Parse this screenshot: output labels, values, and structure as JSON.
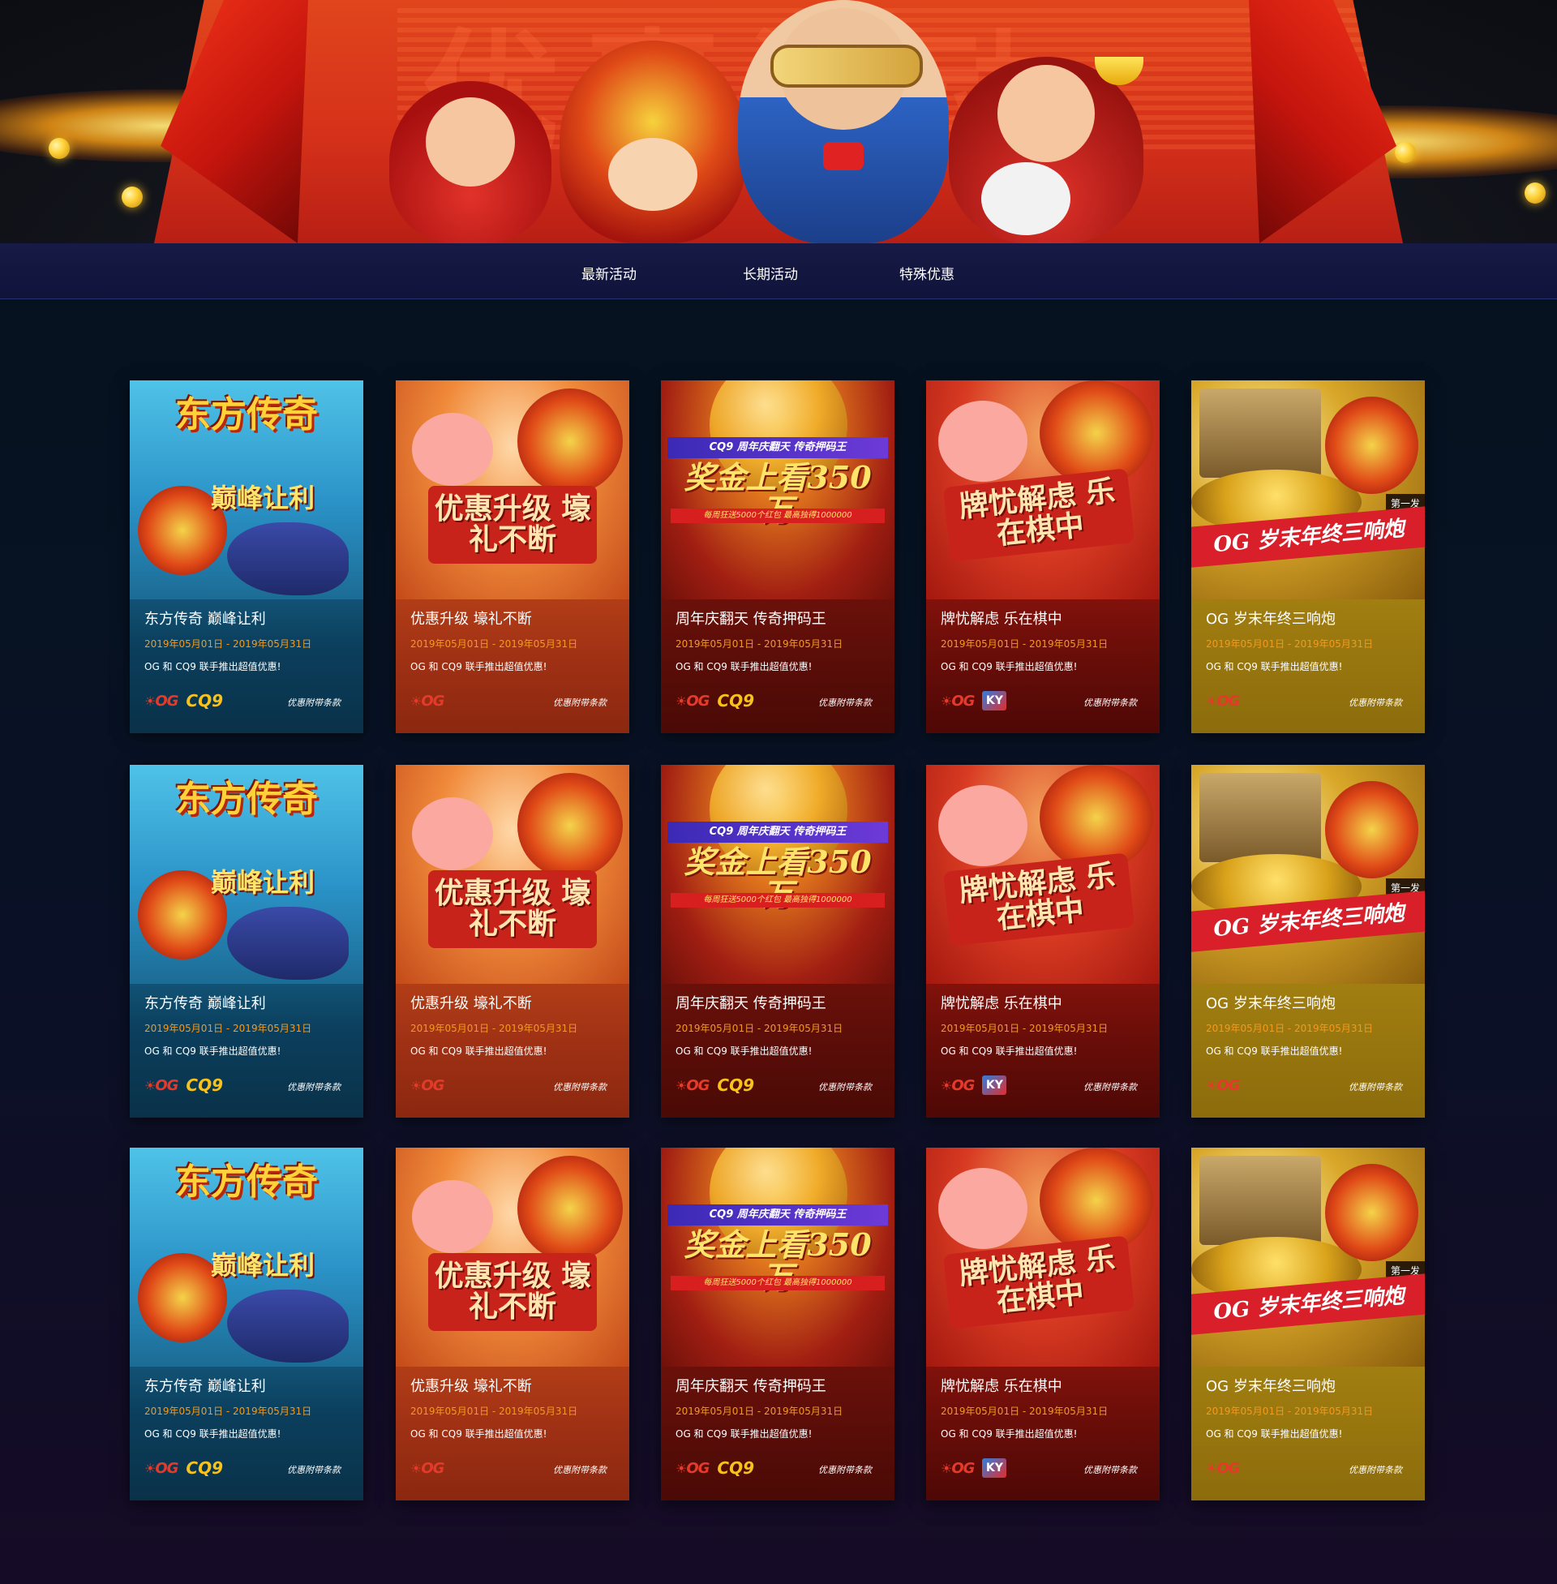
{
  "hero": {
    "watermark": "优惠活动"
  },
  "nav": {
    "tabs": [
      {
        "label": "最新活动"
      },
      {
        "label": "长期活动"
      },
      {
        "label": "特殊优惠"
      }
    ]
  },
  "card_art": {
    "blue": {
      "headline": "东方传奇",
      "sub": "巅峰让利"
    },
    "orange": {
      "headline": "优惠升级 壕礼不断"
    },
    "red": {
      "ribbon": "CQ9 周年庆翻天 传奇押码王",
      "headline": "奖金上看350万",
      "smallline": "每周狂送5000个红包 最高独得1000000"
    },
    "crimson": {
      "headline": "牌忧解虑 乐在棋中"
    },
    "gold": {
      "banner": "OG 岁末年终三响炮",
      "badge": "第一发"
    }
  },
  "cards": [
    {
      "theme": "blue",
      "title": "东方传奇 巅峰让利",
      "date": "2019年05月01日 - 2019年05月31日",
      "desc": "OG 和 CQ9 联手推出超值优惠!",
      "og_logo": "OG",
      "partner_logo": "CQ9",
      "terms": "优惠附带条款"
    },
    {
      "theme": "orange",
      "title": "优惠升级 壕礼不断",
      "date": "2019年05月01日 - 2019年05月31日",
      "desc": "OG 和 CQ9 联手推出超值优惠!",
      "og_logo": "OG",
      "partner_logo": "",
      "terms": "优惠附带条款"
    },
    {
      "theme": "red",
      "title": "周年庆翻天 传奇押码王",
      "date": "2019年05月01日 - 2019年05月31日",
      "desc": "OG 和 CQ9 联手推出超值优惠!",
      "og_logo": "OG",
      "partner_logo": "CQ9",
      "terms": "优惠附带条款"
    },
    {
      "theme": "crimson",
      "title": "牌忧解虑 乐在棋中",
      "date": "2019年05月01日 - 2019年05月31日",
      "desc": "OG 和 CQ9 联手推出超值优惠!",
      "og_logo": "OG",
      "partner_logo": "KY",
      "terms": "优惠附带条款"
    },
    {
      "theme": "gold",
      "title": "OG 岁末年终三响炮",
      "date": "2019年05月01日 - 2019年05月31日",
      "desc": "OG 和 CQ9 联手推出超值优惠!",
      "og_logo": "OG",
      "partner_logo": "",
      "terms": "优惠附带条款"
    }
  ]
}
